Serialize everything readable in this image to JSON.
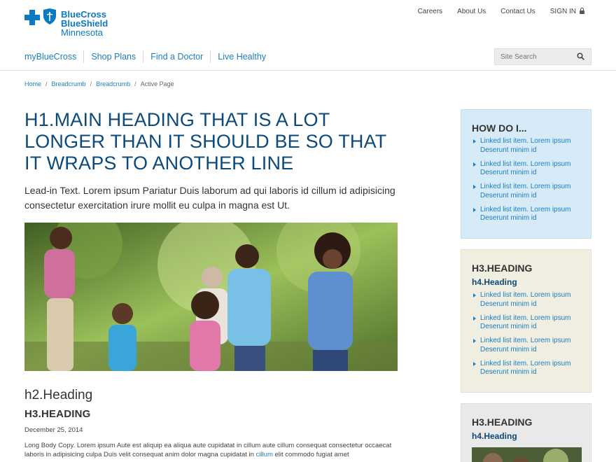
{
  "brand": {
    "line1": "BlueCross",
    "line2": "BlueShield",
    "line3": "Minnesota",
    "accent_color": "#0a7ac2"
  },
  "utility_nav": [
    {
      "label": "Careers"
    },
    {
      "label": "About Us"
    },
    {
      "label": "Contact Us"
    },
    {
      "label": "SIGN IN",
      "icon": "lock-icon"
    }
  ],
  "main_nav": [
    {
      "label": "myBlueCross"
    },
    {
      "label": "Shop Plans"
    },
    {
      "label": "Find a Doctor"
    },
    {
      "label": "Live Healthy"
    }
  ],
  "search": {
    "placeholder": "Site Search",
    "icon": "search-icon"
  },
  "breadcrumb": [
    {
      "label": "Home"
    },
    {
      "label": "Breadcrumb"
    },
    {
      "label": "Breadcrumb"
    },
    {
      "label": "Active Page"
    }
  ],
  "main": {
    "h1": "H1.Main heading that is a lot longer than it should be so that it wraps to another line",
    "lead": "Lead-in Text. Lorem ipsum Pariatur Duis laborum ad qui laboris id cillum id adipisicing consectetur exercitation irure mollit eu culpa in magna est Ut.",
    "h2": "h2.Heading",
    "h3": "H3.HEADING",
    "date": "December 25, 2014",
    "body_before_link": "Long Body Copy. Lorem ipsum Aute est aliquip ea aliqua aute cupidatat in cillum aute cillum consequat consectetur occaecat laboris in adipisicing culpa Duis velit consequat anim dolor magna cupidatat in ",
    "body_link": "cillum",
    "body_after_link": " elit commodo fugiat amet"
  },
  "sidebar": {
    "card1": {
      "title": "HOW DO I...",
      "items": [
        {
          "label": "Linked list item. Lorem ipsum Deserunt minim id"
        },
        {
          "label": "Linked list item. Lorem ipsum Deserunt minim id"
        },
        {
          "label": "Linked list item. Lorem ipsum Deserunt minim id"
        },
        {
          "label": "Linked list item. Lorem ipsum Deserunt minim id"
        }
      ]
    },
    "card2": {
      "title": "H3.HEADING",
      "subtitle": "h4.Heading",
      "items": [
        {
          "label": "Linked list item. Lorem ipsum Deserunt minim id"
        },
        {
          "label": "Linked list item. Lorem ipsum Deserunt minim id"
        },
        {
          "label": "Linked list item. Lorem ipsum Deserunt minim id"
        },
        {
          "label": "Linked list item. Lorem ipsum Deserunt minim id"
        }
      ]
    },
    "card3": {
      "title": "H3.HEADING",
      "subtitle": "h4.Heading"
    }
  },
  "colors": {
    "heading_navy": "#0b4a7a",
    "link_blue": "#1a7fc1",
    "card_blue_bg": "#d6ebf7",
    "card_tan_bg": "#efeee0",
    "card_gray_bg": "#e9e9e9"
  }
}
